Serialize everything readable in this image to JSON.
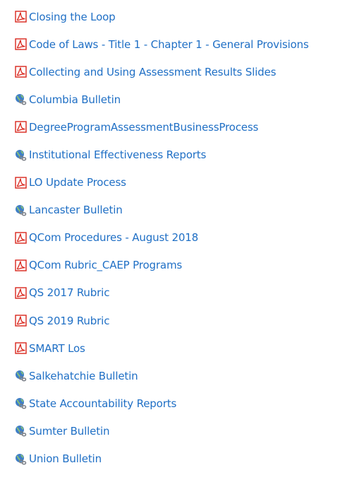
{
  "documents": [
    {
      "label": "Closing the Loop",
      "icon": "pdf-icon"
    },
    {
      "label": "Code of Laws - Title 1 - Chapter 1 - General Provisions",
      "icon": "pdf-icon"
    },
    {
      "label": "Collecting and Using Assessment Results Slides",
      "icon": "pdf-icon"
    },
    {
      "label": "Columbia Bulletin",
      "icon": "web-link-icon"
    },
    {
      "label": "DegreeProgramAssessmentBusinessProcess",
      "icon": "pdf-icon"
    },
    {
      "label": "Institutional Effectiveness Reports",
      "icon": "web-link-icon"
    },
    {
      "label": "LO Update Process",
      "icon": "pdf-icon"
    },
    {
      "label": "Lancaster Bulletin",
      "icon": "web-link-icon"
    },
    {
      "label": "QCom Procedures - August 2018",
      "icon": "pdf-icon"
    },
    {
      "label": "QCom Rubric_CAEP Programs",
      "icon": "pdf-icon"
    },
    {
      "label": "QS 2017 Rubric",
      "icon": "pdf-icon"
    },
    {
      "label": "QS 2019 Rubric",
      "icon": "pdf-icon"
    },
    {
      "label": "SMART Los",
      "icon": "pdf-icon"
    },
    {
      "label": "Salkehatchie Bulletin",
      "icon": "web-link-icon"
    },
    {
      "label": "State Accountability Reports",
      "icon": "web-link-icon"
    },
    {
      "label": "Sumter Bulletin",
      "icon": "web-link-icon"
    },
    {
      "label": "Union Bulletin",
      "icon": "web-link-icon"
    }
  ],
  "colors": {
    "link": "#1f6fc5",
    "pdf_red": "#d9261c",
    "globe_blue": "#3f7fc7",
    "chain_grey": "#7a7f87"
  }
}
